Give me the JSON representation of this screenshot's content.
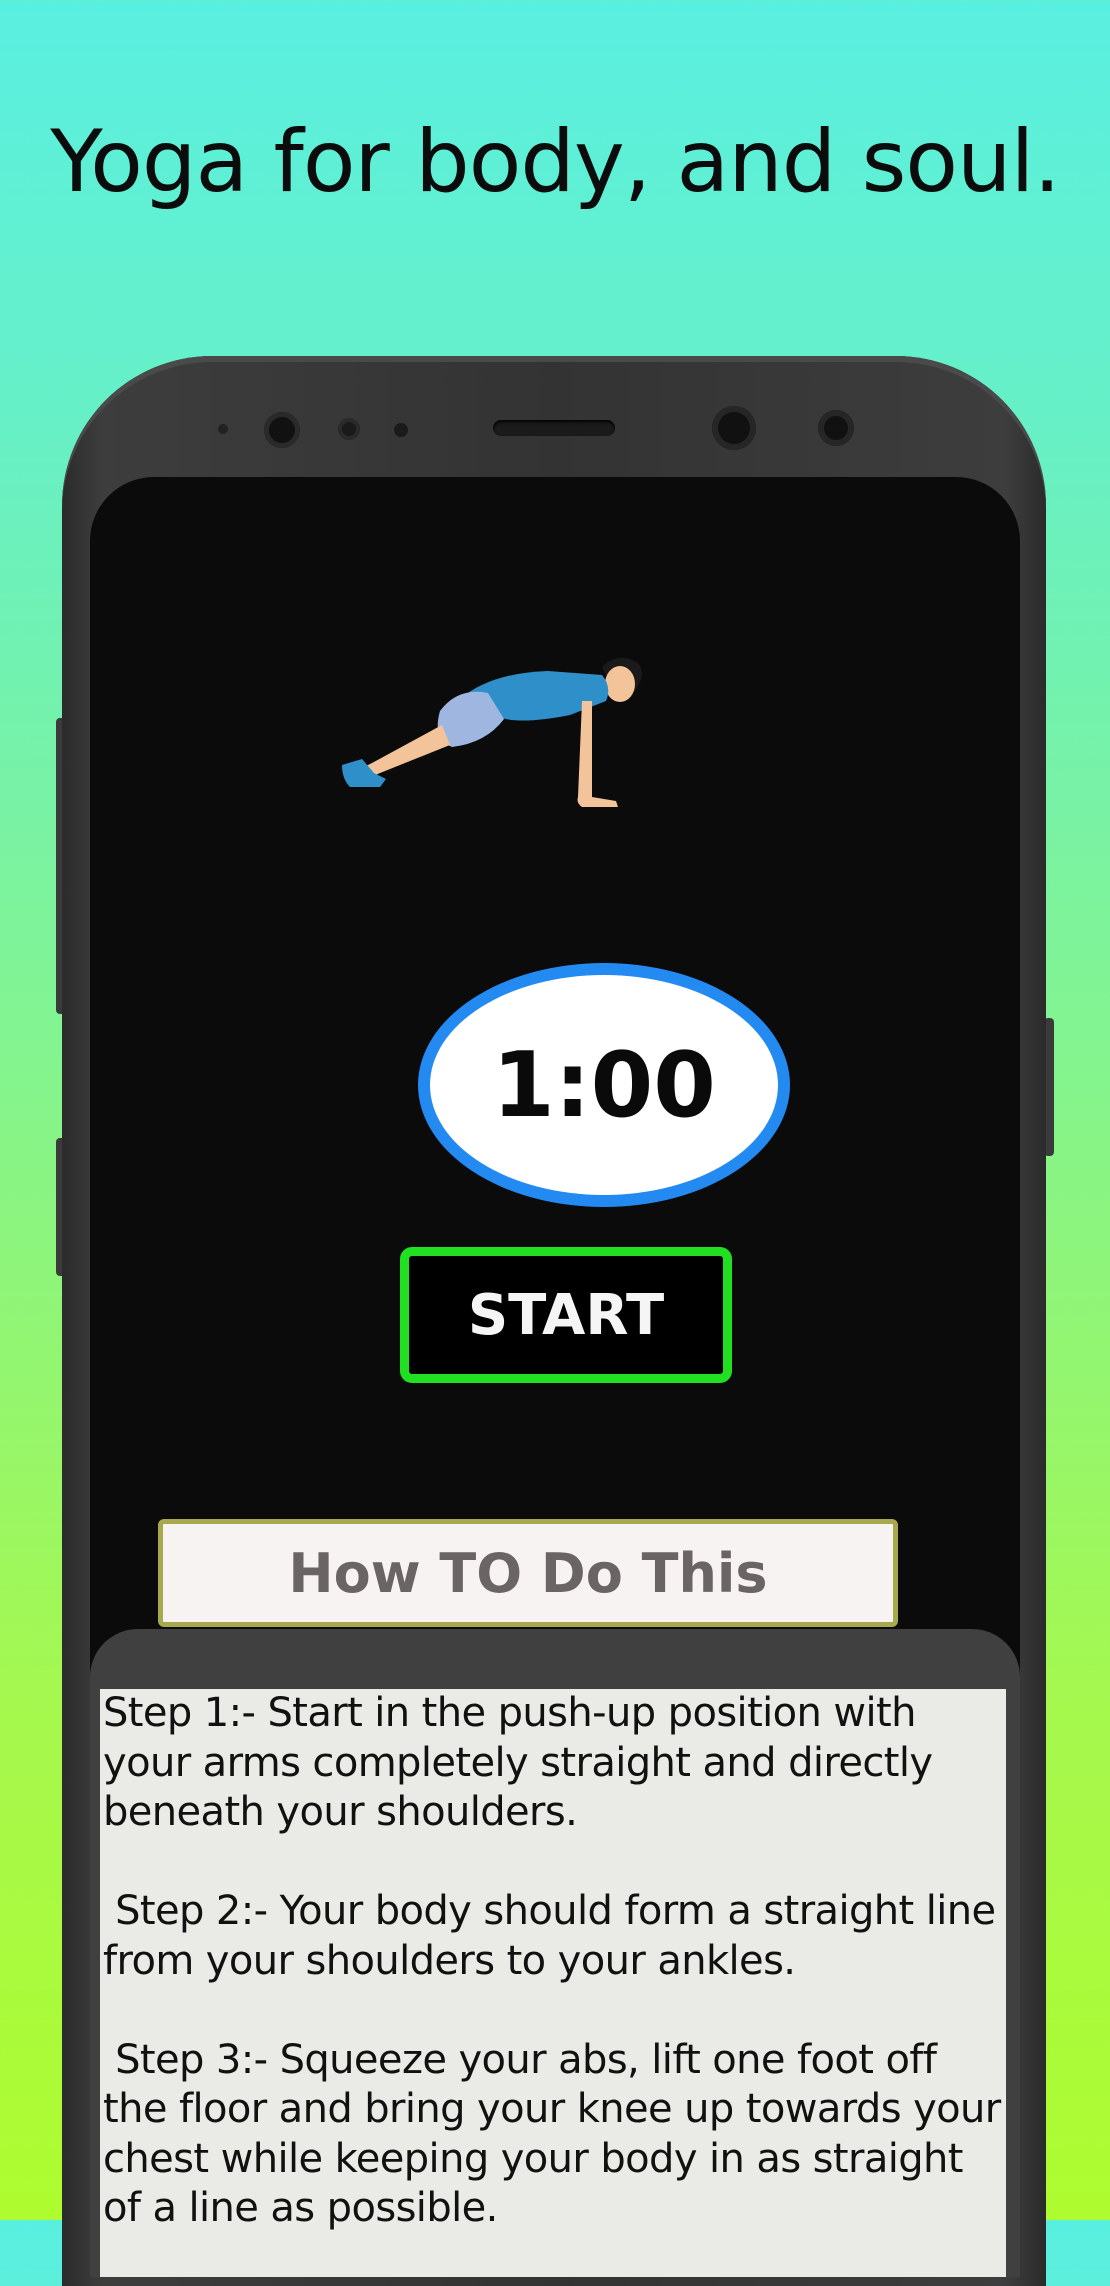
{
  "headline": "Yoga for body, and soul.",
  "workout": {
    "timer": "1:00",
    "start_label": "START",
    "howto_label": "How TO Do This",
    "steps": [
      "Step 1:- Start in the push-up position with your arms completely straight and directly beneath your shoulders.",
      " Step 2:- Your body should form a straight line from your shoulders to your ankles.",
      " Step 3:- Squeeze your abs, lift one foot off the floor and bring your knee up towards your chest while keeping your body in as straight of a line as possible."
    ]
  },
  "colors": {
    "timer_ring": "#238af2",
    "start_border": "#21e021",
    "howto_border": "#a8a94e"
  },
  "icons": [
    "plank-exercise-figure"
  ]
}
